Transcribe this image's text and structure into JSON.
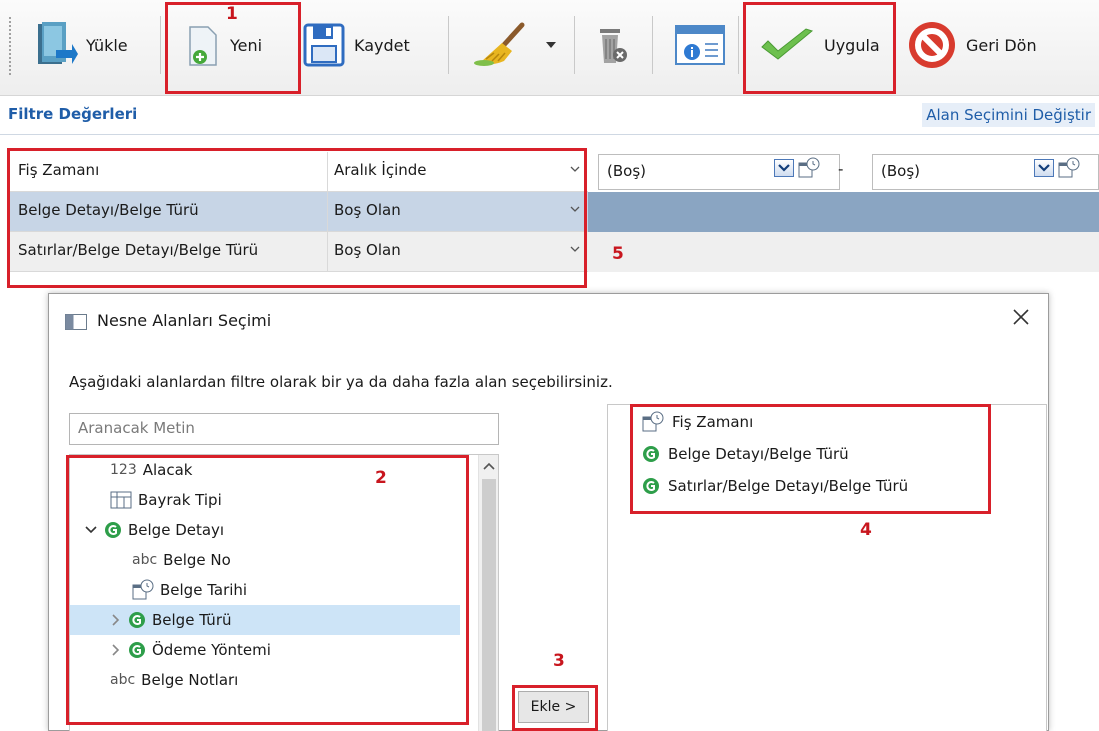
{
  "toolbar": {
    "yukle": "Yükle",
    "yeni": "Yeni",
    "kaydet": "Kaydet",
    "uygula": "Uygula",
    "geri_don": "Geri Dön"
  },
  "filter_bar": {
    "title": "Filtre Değerleri",
    "alan_secimi": "Alan Seçimini Değiştir"
  },
  "filters": [
    {
      "name": "Fiş Zamanı",
      "operator": "Aralık İçinde",
      "value_from": "(Boş)",
      "separator": "-",
      "value_to": "(Boş)"
    },
    {
      "name": "Belge Detayı/Belge Türü",
      "operator": "Boş Olan"
    },
    {
      "name": "Satırlar/Belge Detayı/Belge Türü",
      "operator": "Boş Olan"
    }
  ],
  "annotations": {
    "n1": "1",
    "n2": "2",
    "n3": "3",
    "n4": "4",
    "n5": "5"
  },
  "dialog": {
    "title": "Nesne Alanları Seçimi",
    "description": "Aşağıdaki alanlardan filtre olarak bir ya da daha fazla alan seçebilirsiniz.",
    "search_placeholder": "Aranacak Metin",
    "add_button": "Ekle >",
    "tree": [
      {
        "label": "Alacak",
        "type_label": "123"
      },
      {
        "label": "Bayrak Tipi"
      },
      {
        "label": "Belge Detayı"
      },
      {
        "label": "Belge No",
        "type_label": "abc"
      },
      {
        "label": "Belge Tarihi"
      },
      {
        "label": "Belge Türü"
      },
      {
        "label": "Ödeme Yöntemi"
      },
      {
        "label": "Belge Notları",
        "type_label": "abc"
      }
    ],
    "selected_fields": [
      "Fiş Zamanı",
      "Belge Detayı/Belge Türü",
      "Satırlar/Belge Detayı/Belge Türü"
    ]
  },
  "colors": {
    "accent_red": "#d8202a",
    "link_blue": "#1f5da8",
    "selected_row": "#8aa5c2",
    "green": "#2e9e4a"
  }
}
